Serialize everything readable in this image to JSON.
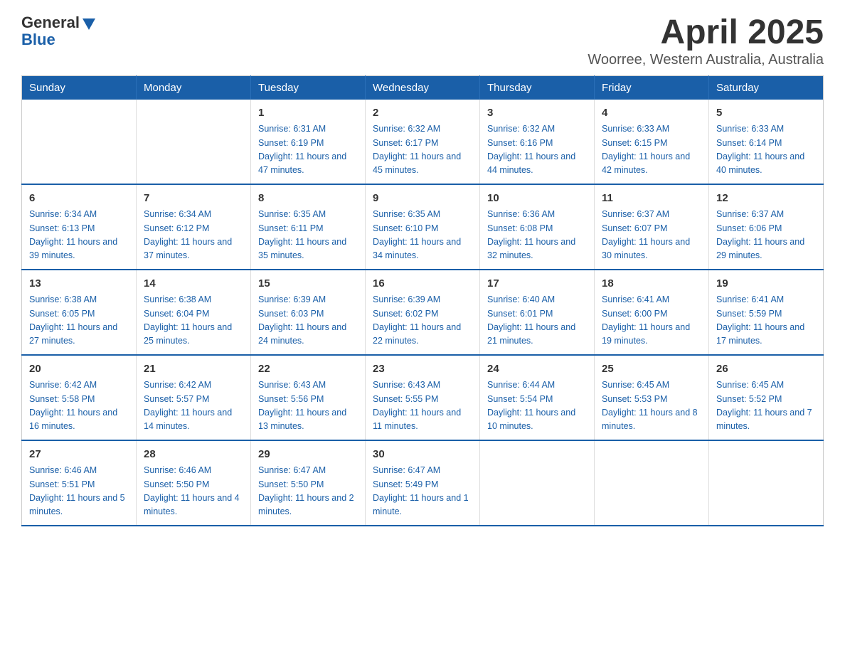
{
  "logo": {
    "general": "General",
    "blue": "Blue"
  },
  "title": "April 2025",
  "subtitle": "Woorree, Western Australia, Australia",
  "headers": [
    "Sunday",
    "Monday",
    "Tuesday",
    "Wednesday",
    "Thursday",
    "Friday",
    "Saturday"
  ],
  "weeks": [
    [
      {
        "day": "",
        "info": ""
      },
      {
        "day": "",
        "info": ""
      },
      {
        "day": "1",
        "info": "Sunrise: 6:31 AM\nSunset: 6:19 PM\nDaylight: 11 hours and 47 minutes."
      },
      {
        "day": "2",
        "info": "Sunrise: 6:32 AM\nSunset: 6:17 PM\nDaylight: 11 hours and 45 minutes."
      },
      {
        "day": "3",
        "info": "Sunrise: 6:32 AM\nSunset: 6:16 PM\nDaylight: 11 hours and 44 minutes."
      },
      {
        "day": "4",
        "info": "Sunrise: 6:33 AM\nSunset: 6:15 PM\nDaylight: 11 hours and 42 minutes."
      },
      {
        "day": "5",
        "info": "Sunrise: 6:33 AM\nSunset: 6:14 PM\nDaylight: 11 hours and 40 minutes."
      }
    ],
    [
      {
        "day": "6",
        "info": "Sunrise: 6:34 AM\nSunset: 6:13 PM\nDaylight: 11 hours and 39 minutes."
      },
      {
        "day": "7",
        "info": "Sunrise: 6:34 AM\nSunset: 6:12 PM\nDaylight: 11 hours and 37 minutes."
      },
      {
        "day": "8",
        "info": "Sunrise: 6:35 AM\nSunset: 6:11 PM\nDaylight: 11 hours and 35 minutes."
      },
      {
        "day": "9",
        "info": "Sunrise: 6:35 AM\nSunset: 6:10 PM\nDaylight: 11 hours and 34 minutes."
      },
      {
        "day": "10",
        "info": "Sunrise: 6:36 AM\nSunset: 6:08 PM\nDaylight: 11 hours and 32 minutes."
      },
      {
        "day": "11",
        "info": "Sunrise: 6:37 AM\nSunset: 6:07 PM\nDaylight: 11 hours and 30 minutes."
      },
      {
        "day": "12",
        "info": "Sunrise: 6:37 AM\nSunset: 6:06 PM\nDaylight: 11 hours and 29 minutes."
      }
    ],
    [
      {
        "day": "13",
        "info": "Sunrise: 6:38 AM\nSunset: 6:05 PM\nDaylight: 11 hours and 27 minutes."
      },
      {
        "day": "14",
        "info": "Sunrise: 6:38 AM\nSunset: 6:04 PM\nDaylight: 11 hours and 25 minutes."
      },
      {
        "day": "15",
        "info": "Sunrise: 6:39 AM\nSunset: 6:03 PM\nDaylight: 11 hours and 24 minutes."
      },
      {
        "day": "16",
        "info": "Sunrise: 6:39 AM\nSunset: 6:02 PM\nDaylight: 11 hours and 22 minutes."
      },
      {
        "day": "17",
        "info": "Sunrise: 6:40 AM\nSunset: 6:01 PM\nDaylight: 11 hours and 21 minutes."
      },
      {
        "day": "18",
        "info": "Sunrise: 6:41 AM\nSunset: 6:00 PM\nDaylight: 11 hours and 19 minutes."
      },
      {
        "day": "19",
        "info": "Sunrise: 6:41 AM\nSunset: 5:59 PM\nDaylight: 11 hours and 17 minutes."
      }
    ],
    [
      {
        "day": "20",
        "info": "Sunrise: 6:42 AM\nSunset: 5:58 PM\nDaylight: 11 hours and 16 minutes."
      },
      {
        "day": "21",
        "info": "Sunrise: 6:42 AM\nSunset: 5:57 PM\nDaylight: 11 hours and 14 minutes."
      },
      {
        "day": "22",
        "info": "Sunrise: 6:43 AM\nSunset: 5:56 PM\nDaylight: 11 hours and 13 minutes."
      },
      {
        "day": "23",
        "info": "Sunrise: 6:43 AM\nSunset: 5:55 PM\nDaylight: 11 hours and 11 minutes."
      },
      {
        "day": "24",
        "info": "Sunrise: 6:44 AM\nSunset: 5:54 PM\nDaylight: 11 hours and 10 minutes."
      },
      {
        "day": "25",
        "info": "Sunrise: 6:45 AM\nSunset: 5:53 PM\nDaylight: 11 hours and 8 minutes."
      },
      {
        "day": "26",
        "info": "Sunrise: 6:45 AM\nSunset: 5:52 PM\nDaylight: 11 hours and 7 minutes."
      }
    ],
    [
      {
        "day": "27",
        "info": "Sunrise: 6:46 AM\nSunset: 5:51 PM\nDaylight: 11 hours and 5 minutes."
      },
      {
        "day": "28",
        "info": "Sunrise: 6:46 AM\nSunset: 5:50 PM\nDaylight: 11 hours and 4 minutes."
      },
      {
        "day": "29",
        "info": "Sunrise: 6:47 AM\nSunset: 5:50 PM\nDaylight: 11 hours and 2 minutes."
      },
      {
        "day": "30",
        "info": "Sunrise: 6:47 AM\nSunset: 5:49 PM\nDaylight: 11 hours and 1 minute."
      },
      {
        "day": "",
        "info": ""
      },
      {
        "day": "",
        "info": ""
      },
      {
        "day": "",
        "info": ""
      }
    ]
  ]
}
